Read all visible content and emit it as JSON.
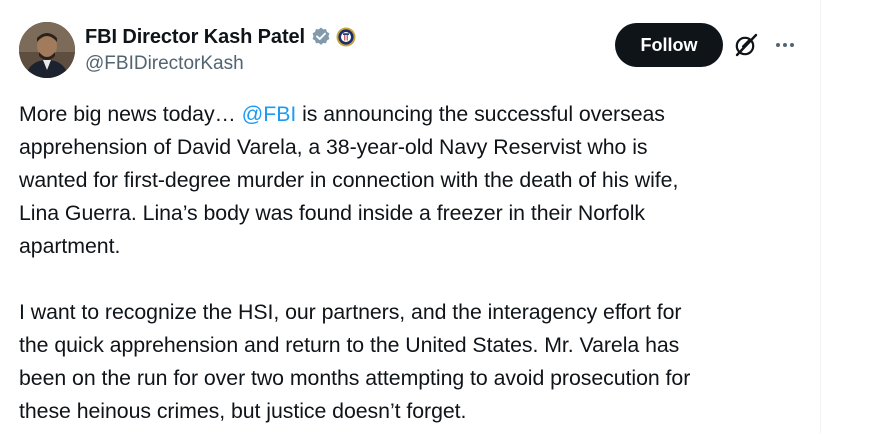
{
  "author": {
    "display_name": "FBI Director Kash Patel",
    "handle": "@FBIDirectorKash",
    "verified_icon": "verified-badge-icon",
    "affiliation_icon": "fbi-seal-icon"
  },
  "actions": {
    "follow_label": "Follow",
    "grok_icon": "grok-icon",
    "more_icon": "more-icon"
  },
  "post": {
    "p1": {
      "l1_pre": "More big news today… ",
      "l1_mention": "@FBI",
      "l1_post": " is announcing the successful overseas",
      "l2": "apprehension of David Varela, a 38-year-old Navy Reservist who is",
      "l3": "wanted for first-degree murder in connection with the death of his wife,",
      "l4": "Lina Guerra.  Lina’s body was found inside a freezer in their Norfolk",
      "l5": "apartment."
    },
    "p2": {
      "l1": "I want to recognize the HSI, our partners, and the interagency effort for",
      "l2": "the quick apprehension and return to the United States. Mr. Varela has",
      "l3": "been on the run for over two months attempting to avoid prosecution for",
      "l4": "these heinous crimes, but justice doesn’t forget."
    }
  },
  "colors": {
    "text": "#0f1419",
    "secondary": "#536471",
    "link": "#1d9bf0",
    "follow_bg": "#0f1419"
  }
}
